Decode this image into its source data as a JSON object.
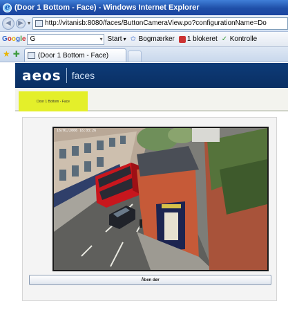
{
  "window": {
    "title": "(Door 1 Bottom - Face) - Windows Internet Explorer"
  },
  "address_bar": {
    "url": "http://vitanisb:8080/faces/ButtonCameraView.po?configurationName=Do"
  },
  "google_toolbar": {
    "logo": "Google",
    "search_value": "G",
    "items": [
      "Start",
      "Bogmærker",
      "1 blokeret",
      "Kontrolle"
    ]
  },
  "tabs": [
    {
      "label": "(Door 1 Bottom - Face)"
    }
  ],
  "app": {
    "logo": "aeos",
    "product": "faces",
    "nav_tab": "Door 1 Bottom - Face"
  },
  "camera": {
    "timestamp": "16/01/2006 16:03:26",
    "bus_color": "#c8161d"
  },
  "actions": {
    "open_door_label": "Åben dør"
  },
  "colors": {
    "header_bg": "#0d3b78",
    "nav_tab_bg": "#e4ef2a"
  }
}
